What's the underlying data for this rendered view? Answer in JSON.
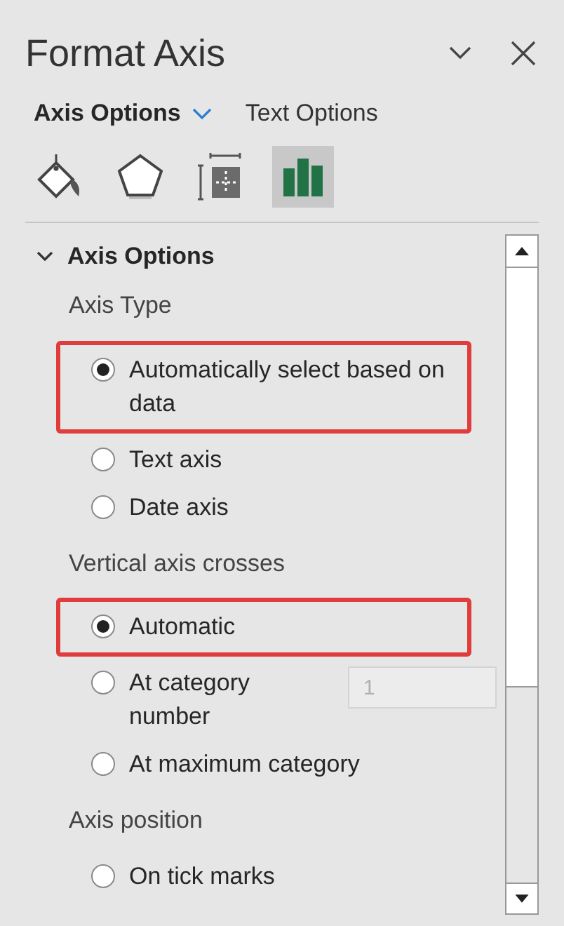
{
  "pane": {
    "title": "Format Axis"
  },
  "tabs": [
    {
      "label": "Axis Options",
      "selected": true
    },
    {
      "label": "Text Options",
      "selected": false
    }
  ],
  "icon_tabs": [
    {
      "kind": "fill",
      "selected": false
    },
    {
      "kind": "effects",
      "selected": false
    },
    {
      "kind": "size",
      "selected": false
    },
    {
      "kind": "axis",
      "selected": true
    }
  ],
  "section": {
    "title": "Axis Options",
    "expanded": true,
    "groups": [
      {
        "label": "Axis Type",
        "options": [
          {
            "label": "Automatically select based on data",
            "selected": true,
            "highlighted": true
          },
          {
            "label": "Text axis",
            "selected": false,
            "highlighted": false
          },
          {
            "label": "Date axis",
            "selected": false,
            "highlighted": false
          }
        ]
      },
      {
        "label": "Vertical axis crosses",
        "options": [
          {
            "label": "Automatic",
            "selected": true,
            "highlighted": true
          },
          {
            "label": "At category number",
            "selected": false,
            "highlighted": false,
            "field": {
              "value": "1",
              "disabled": true
            }
          },
          {
            "label": "At maximum category",
            "selected": false,
            "highlighted": false
          }
        ]
      },
      {
        "label": "Axis position",
        "options": [
          {
            "label": "On tick marks",
            "selected": false,
            "highlighted": false
          }
        ]
      }
    ]
  }
}
